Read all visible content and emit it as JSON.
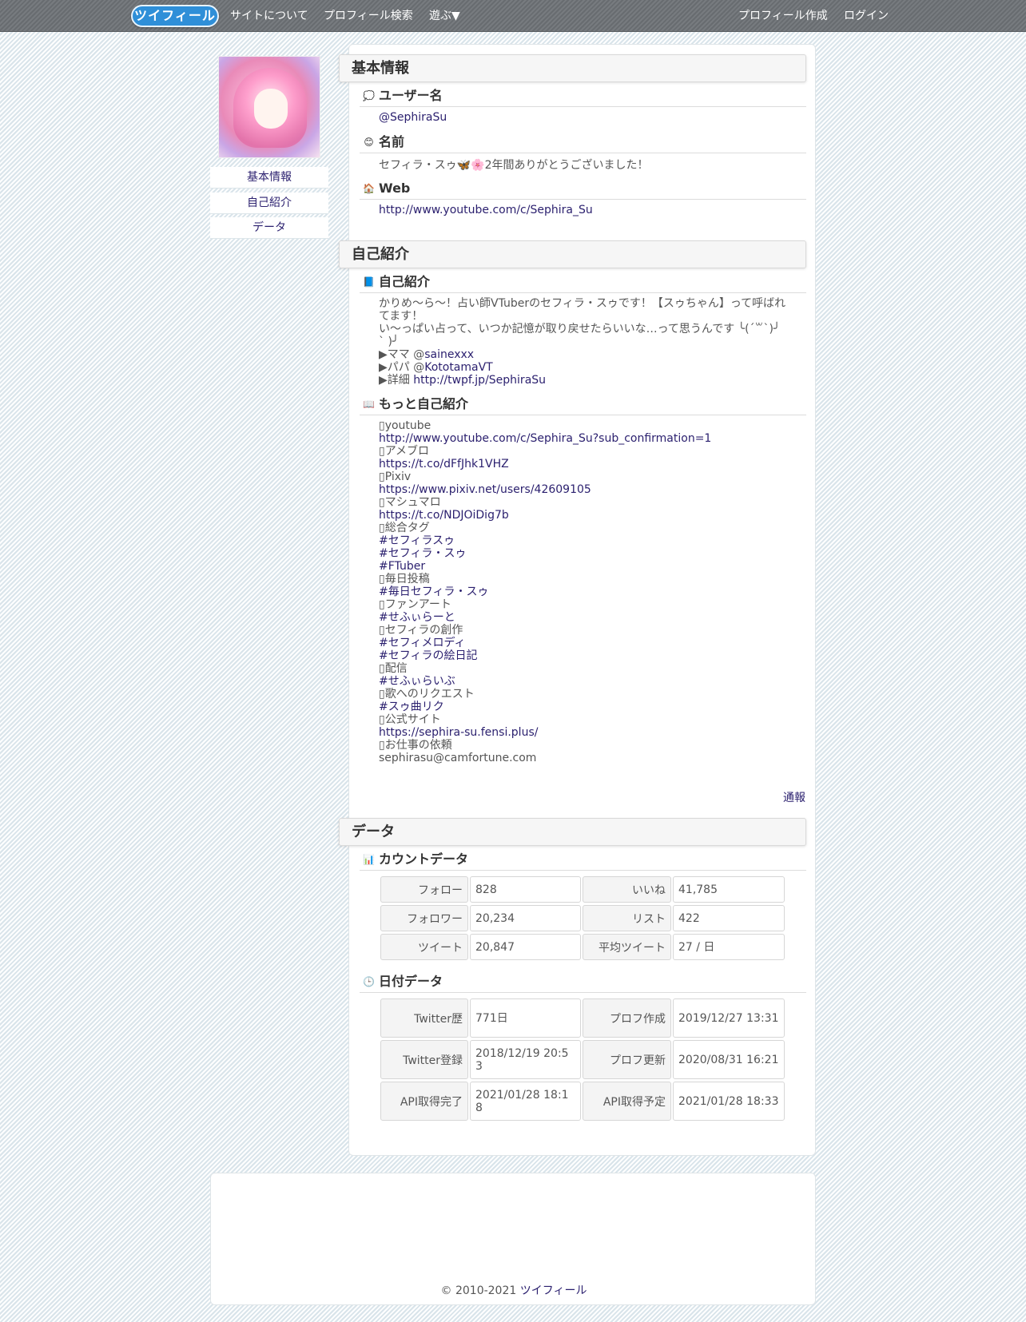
{
  "nav": {
    "logo": "ツイフィール",
    "about": "サイトについて",
    "search": "プロフィール検索",
    "play": "遊ぶ▼",
    "create": "プロフィール作成",
    "login": "ログイン"
  },
  "sidebar": {
    "items": [
      "基本情報",
      "自己紹介",
      "データ"
    ]
  },
  "basic": {
    "title": "基本情報",
    "username_label": "ユーザー名",
    "username": "@SephiraSu",
    "name_label": "名前",
    "name": "セフィラ・スゥ🦋🌸2年間ありがとうございました！",
    "web_label": "Web",
    "web": "http://www.youtube.com/c/Sephira_Su"
  },
  "intro": {
    "title": "自己紹介",
    "bio_label": "自己紹介",
    "bio_lines": [
      "かりめ〜ら〜！占い師VTuberのセフィラ・スゥです！【スゥちゃん】って呼ばれ",
      "てます！",
      "い〜っぱい占って、いつか記憶が取り戻せたらいいな…って思うんです ╰(´꒳`)╯",
      "`   )╯"
    ],
    "mama_prefix": "▶ママ ",
    "mama_at": "@",
    "mama_link": "sainexxx",
    "papa_prefix": "▶パパ ",
    "papa_at": "@",
    "papa_link": "KototamaVT",
    "detail_prefix": "▶詳細 ",
    "detail_link": "http://twpf.jp/SephiraSu",
    "more_label": "もっと自己紹介",
    "more_lines": [
      {
        "text": "▯youtube",
        "link": false
      },
      {
        "text": "http://www.youtube.com/c/Sephira_Su?sub_confirmation=1",
        "link": true
      },
      {
        "text": "▯アメブロ",
        "link": false
      },
      {
        "text": "https://t.co/dFfJhk1VHZ",
        "link": true
      },
      {
        "text": "▯Pixiv",
        "link": false
      },
      {
        "text": "https://www.pixiv.net/users/42609105",
        "link": true
      },
      {
        "text": "▯マシュマロ",
        "link": false
      },
      {
        "text": "https://t.co/NDJOiDig7b",
        "link": true
      },
      {
        "text": "▯総合タグ",
        "link": false
      },
      {
        "text": "#セフィラスゥ",
        "link": true
      },
      {
        "text": "#セフィラ・スゥ",
        "link": true
      },
      {
        "text": "#FTuber",
        "link": true
      },
      {
        "text": "▯毎日投稿",
        "link": false
      },
      {
        "text": "#毎日セフィラ・スゥ",
        "link": true
      },
      {
        "text": "▯ファンアート",
        "link": false
      },
      {
        "text": "#せふぃらーと",
        "link": true
      },
      {
        "text": "▯セフィラの創作",
        "link": false
      },
      {
        "text": "#セフィメロディ",
        "link": true
      },
      {
        "text": "#セフィラの絵日記",
        "link": true
      },
      {
        "text": "▯配信",
        "link": false
      },
      {
        "text": "#せふぃらいぶ",
        "link": true
      },
      {
        "text": "▯歌へのリクエスト",
        "link": false
      },
      {
        "text": "#スゥ曲リク",
        "link": true
      },
      {
        "text": "▯公式サイト",
        "link": false
      },
      {
        "text": "https://sephira-su.fensi.plus/",
        "link": true
      },
      {
        "text": "▯お仕事の依頼",
        "link": false
      },
      {
        "text": "sephirasu@camfortune.com",
        "link": false
      }
    ],
    "report": "通報"
  },
  "data": {
    "title": "データ",
    "count_label": "カウントデータ",
    "count_rows": [
      {
        "l1": "フォロー",
        "v1": "828",
        "l2": "いいね",
        "v2": "41,785"
      },
      {
        "l1": "フォロワー",
        "v1": "20,234",
        "l2": "リスト",
        "v2": "422"
      },
      {
        "l1": "ツイート",
        "v1": "20,847",
        "l2": "平均ツイート",
        "v2": "27 / 日"
      }
    ],
    "date_label": "日付データ",
    "date_rows": [
      {
        "l1": "Twitter歴",
        "v1": "771日",
        "l2": "プロフ作成",
        "v2": "2019/12/27 13:31"
      },
      {
        "l1": "Twitter登録",
        "v1": "2018/12/19 20:53",
        "l2": "プロフ更新",
        "v2": "2020/08/31 16:21"
      },
      {
        "l1": "API取得完了",
        "v1": "2021/01/28 18:18",
        "l2": "API取得予定",
        "v2": "2021/01/28 18:33"
      }
    ]
  },
  "footer": {
    "copyright": "© 2010-2021 ",
    "brand": "ツイフィール"
  }
}
